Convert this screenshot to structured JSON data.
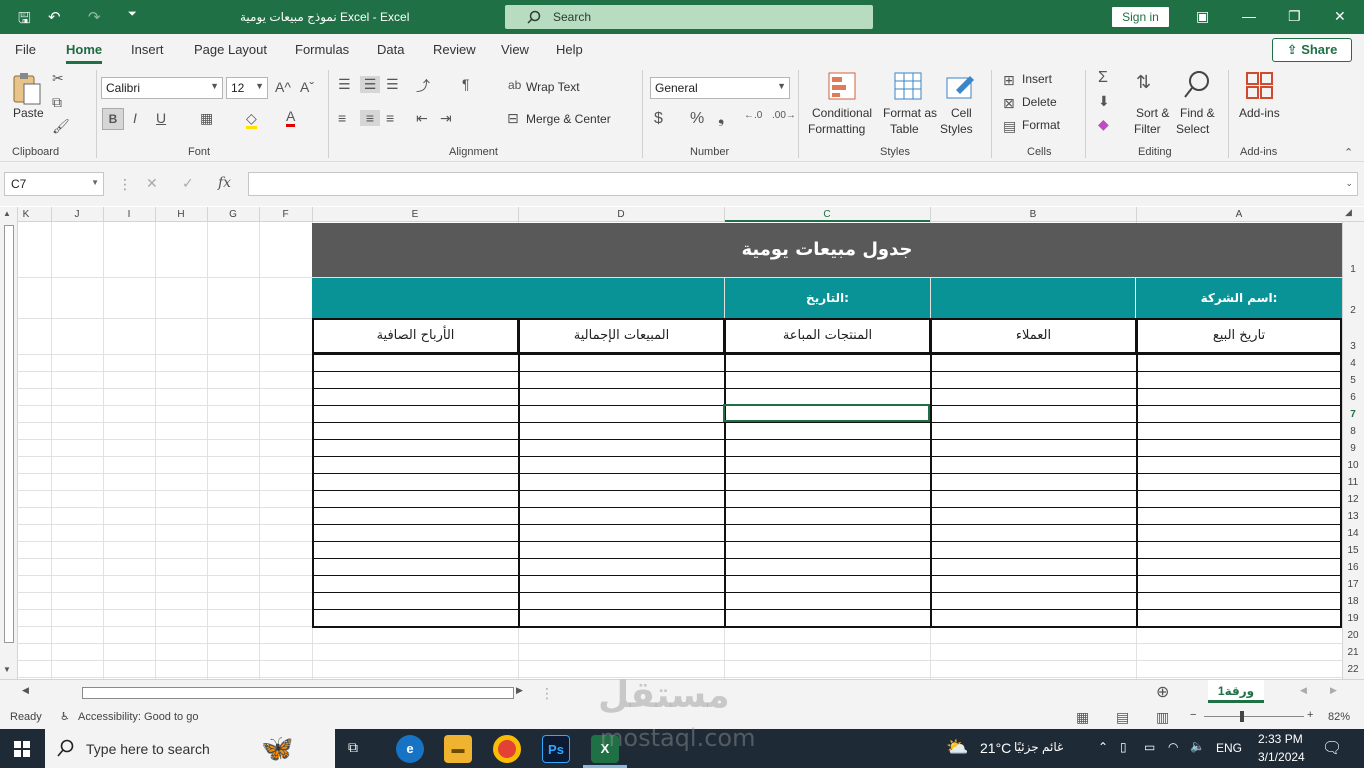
{
  "titlebar": {
    "doc_title": "نموذج مبيعات يومية Excel  -  Excel",
    "search_placeholder": "Search",
    "signin": "Sign in"
  },
  "tabs": [
    "File",
    "Home",
    "Insert",
    "Page Layout",
    "Formulas",
    "Data",
    "Review",
    "View",
    "Help"
  ],
  "share_label": "Share",
  "ribbon": {
    "clipboard": {
      "label": "Clipboard",
      "paste": "Paste"
    },
    "font": {
      "label": "Font",
      "name": "Calibri",
      "size": "12"
    },
    "alignment": {
      "label": "Alignment",
      "wrap": "Wrap Text",
      "merge": "Merge & Center"
    },
    "number": {
      "label": "Number",
      "format": "General"
    },
    "styles": {
      "label": "Styles",
      "conditional": "Conditional",
      "conditional2": "Formatting",
      "format_as": "Format as",
      "format_as2": "Table",
      "cell": "Cell",
      "cell2": "Styles"
    },
    "cells": {
      "label": "Cells",
      "insert": "Insert",
      "delete": "Delete",
      "format": "Format"
    },
    "editing": {
      "label": "Editing",
      "sort": "Sort &",
      "sort2": "Filter",
      "find": "Find &",
      "find2": "Select"
    },
    "addins": {
      "label": "Add-ins",
      "addins": "Add-ins"
    }
  },
  "formula_bar": {
    "namebox": "C7",
    "fx": "fx"
  },
  "columns": [
    "K",
    "J",
    "I",
    "H",
    "G",
    "F",
    "E",
    "D",
    "C",
    "B",
    "A"
  ],
  "rows": [
    "1",
    "2",
    "3",
    "4",
    "5",
    "6",
    "7",
    "8",
    "9",
    "10",
    "11",
    "12",
    "13",
    "14",
    "15",
    "16",
    "17",
    "18",
    "19",
    "20",
    "21",
    "22"
  ],
  "sheet": {
    "title": "جدول مبيعات يومية",
    "company_label": "اسم الشركة:",
    "date_label": "التاريخ:",
    "headers": {
      "A": "تاريخ البيع",
      "B": "العملاء",
      "C": "المنتجات المباعة",
      "D": "المبيعات الإجمالية",
      "E": "الأرباح الصافية"
    }
  },
  "sheet_tab": "ورقة1",
  "status": {
    "ready": "Ready",
    "accessibility": "Accessibility: Good to go",
    "zoom": "82%"
  },
  "taskbar": {
    "search_placeholder": "Type here to search",
    "weather": "21°C",
    "weather_text": "غائم جزئيًا",
    "lang": "ENG",
    "time": "2:33 PM",
    "date": "3/1/2024"
  },
  "watermark": {
    "arabic": "مستقل",
    "latin": "mostaql.com"
  },
  "colors": {
    "title_bar": "#1f7145",
    "band_dark": "#595959",
    "band_teal": "#0a9396"
  }
}
